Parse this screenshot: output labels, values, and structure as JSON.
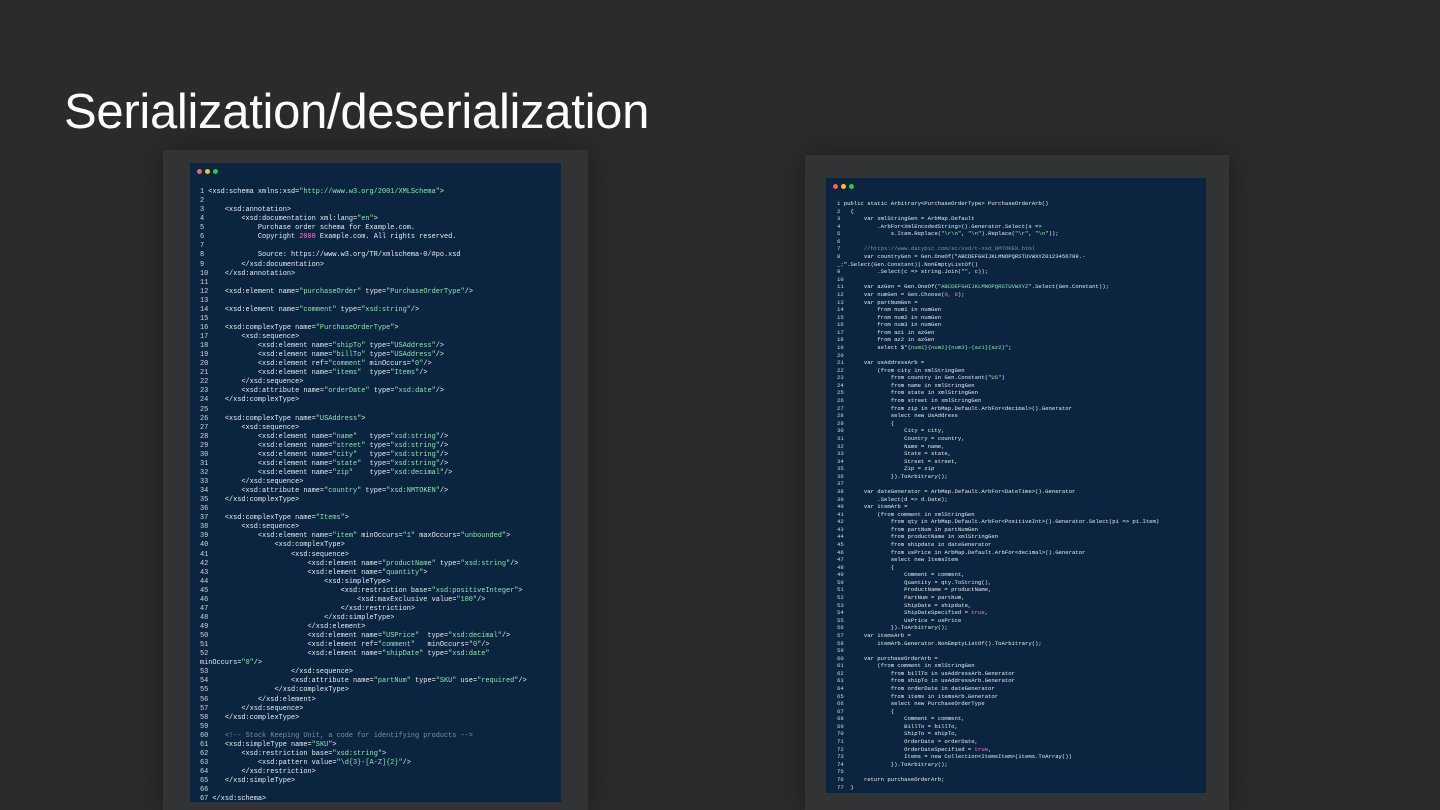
{
  "slide": {
    "title": "Serialization/deserialization"
  },
  "left_window": {
    "language": "xml",
    "lines": [
      "1 <xsd:schema xmlns:xsd=\"http://www.w3.org/2001/XMLSchema\">",
      "2",
      "3     <xsd:annotation>",
      "4         <xsd:documentation xml:lang=\"en\">",
      "5             Purchase order schema for Example.com.",
      "6             Copyright 2000 Example.com. All rights reserved.",
      "7",
      "8             Source: https://www.w3.org/TR/xmlschema-0/#po.xsd",
      "9         </xsd:documentation>",
      "10    </xsd:annotation>",
      "11",
      "12    <xsd:element name=\"purchaseOrder\" type=\"PurchaseOrderType\"/>",
      "13",
      "14    <xsd:element name=\"comment\" type=\"xsd:string\"/>",
      "15",
      "16    <xsd:complexType name=\"PurchaseOrderType\">",
      "17        <xsd:sequence>",
      "18            <xsd:element name=\"shipTo\" type=\"USAddress\"/>",
      "19            <xsd:element name=\"billTo\" type=\"USAddress\"/>",
      "20            <xsd:element ref=\"comment\" minOccurs=\"0\"/>",
      "21            <xsd:element name=\"items\"  type=\"Items\"/>",
      "22        </xsd:sequence>",
      "23        <xsd:attribute name=\"orderDate\" type=\"xsd:date\"/>",
      "24    </xsd:complexType>",
      "25",
      "26    <xsd:complexType name=\"USAddress\">",
      "27        <xsd:sequence>",
      "28            <xsd:element name=\"name\"   type=\"xsd:string\"/>",
      "29            <xsd:element name=\"street\" type=\"xsd:string\"/>",
      "30            <xsd:element name=\"city\"   type=\"xsd:string\"/>",
      "31            <xsd:element name=\"state\"  type=\"xsd:string\"/>",
      "32            <xsd:element name=\"zip\"    type=\"xsd:decimal\"/>",
      "33        </xsd:sequence>",
      "34        <xsd:attribute name=\"country\" type=\"xsd:NMTOKEN\"/>",
      "35    </xsd:complexType>",
      "36",
      "37    <xsd:complexType name=\"Items\">",
      "38        <xsd:sequence>",
      "39            <xsd:element name=\"item\" minOccurs=\"1\" maxOccurs=\"unbounded\">",
      "40                <xsd:complexType>",
      "41                    <xsd:sequence>",
      "42                        <xsd:element name=\"productName\" type=\"xsd:string\"/>",
      "43                        <xsd:element name=\"quantity\">",
      "44                            <xsd:simpleType>",
      "45                                <xsd:restriction base=\"xsd:positiveInteger\">",
      "46                                    <xsd:maxExclusive value=\"100\"/>",
      "47                                </xsd:restriction>",
      "48                            </xsd:simpleType>",
      "49                        </xsd:element>",
      "50                        <xsd:element name=\"USPrice\"  type=\"xsd:decimal\"/>",
      "51                        <xsd:element ref=\"comment\"   minOccurs=\"0\"/>",
      "52                        <xsd:element name=\"shipDate\" type=\"xsd:date\"",
      "minOccurs=\"0\"/>",
      "53                    </xsd:sequence>",
      "54                    <xsd:attribute name=\"partNum\" type=\"SKU\" use=\"required\"/>",
      "55                </xsd:complexType>",
      "56            </xsd:element>",
      "57        </xsd:sequence>",
      "58    </xsd:complexType>",
      "59",
      "60    <!-- Stock Keeping Unit, a code for identifying products -->",
      "61    <xsd:simpleType name=\"SKU\">",
      "62        <xsd:restriction base=\"xsd:string\">",
      "63            <xsd:pattern value=\"\\d{3}-[A-Z]{2}\"/>",
      "64        </xsd:restriction>",
      "65    </xsd:simpleType>",
      "66",
      "67 </xsd:schema>"
    ]
  },
  "right_window": {
    "language": "csharp",
    "lines": [
      "1 public static Arbitrary<PurchaseOrderType> PurchaseOrderArb()",
      "2   {",
      "3       var xmlStringGen = ArbMap.Default",
      "4           .ArbFor<XmlEncodedString>().Generator.Select(s =>",
      "5               s.Item.Replace(\"\\r\\n\", \"\\n\").Replace(\"\\r\", \"\\n\"));",
      "6",
      "7       //https://www.datypic.com/sc/xsd/t-xsd_NMTOKEN.html",
      "8       var countryGen = Gen.OneOf(\"ABCDEFGHIJKLMNOPQRSTUVWXYZ0123456789.-",
      "_:\".Select(Gen.Constant)).NonEmptyListOf()",
      "9           .Select(c => string.Join(\"\", c));",
      "10",
      "11      var azGen = Gen.OneOf(\"ABCDEFGHIJKLMNOPQRSTUVWXYZ\".Select(Gen.Constant));",
      "12      var numGen = Gen.Choose(0, 9);",
      "13      var partNumGen =",
      "14          from num1 in numGen",
      "15          from num2 in numGen",
      "16          from num3 in numGen",
      "17          from az1 in azGen",
      "18          from az2 in azGen",
      "19          select $\"{num1}{num2}{num3}-{az1}{az2}\";",
      "20",
      "21      var usAddressArb =",
      "22          (from city in xmlStringGen",
      "23              from country in Gen.Constant(\"US\")",
      "24              from name in xmlStringGen",
      "25              from state in xmlStringGen",
      "26              from street in xmlStringGen",
      "27              from zip in ArbMap.Default.ArbFor<decimal>().Generator",
      "28              select new UsAddress",
      "29              {",
      "30                  City = city,",
      "31                  Country = country,",
      "32                  Name = name,",
      "33                  State = state,",
      "34                  Street = street,",
      "35                  Zip = zip",
      "36              }).ToArbitrary();",
      "37",
      "38      var dateGenerator = ArbMap.Default.ArbFor<DateTime>().Generator",
      "39          .Select(d => d.Date);",
      "40      var itemArb =",
      "41          (from comment in xmlStringGen",
      "42              from qty in ArbMap.Default.ArbFor<PositiveInt>().Generator.Select(pi => pi.Item)",
      "43              from partNum in partNumGen",
      "44              from productName in xmlStringGen",
      "45              from shipdate in dateGenerator",
      "46              from usPrice in ArbMap.Default.ArbFor<decimal>().Generator",
      "47              select new ItemsItem",
      "48              {",
      "49                  Comment = comment,",
      "50                  Quantity = qty.ToString(),",
      "51                  ProductName = productName,",
      "52                  PartNum = partNum,",
      "53                  ShipDate = shipdate,",
      "54                  ShipDateSpecified = true,",
      "55                  UsPrice = usPrice",
      "56              }).ToArbitrary();",
      "57      var itemsArb =",
      "58          itemArb.Generator.NonEmptyListOf().ToArbitrary();",
      "59",
      "60      var purchaseOrderArb =",
      "61          (from comment in xmlStringGen",
      "62              from billTo in usAddressArb.Generator",
      "63              from shipTo in usAddressArb.Generator",
      "64              from orderDate in dateGenerator",
      "65              from items in itemsArb.Generator",
      "66              select new PurchaseOrderType",
      "67              {",
      "68                  Comment = comment,",
      "69                  BillTo = billTo,",
      "70                  ShipTo = shipTo,",
      "71                  OrderDate = orderDate,",
      "72                  OrderDateSpecified = true,",
      "73                  Items = new Collection<ItemsItem>(items.ToArray())",
      "74              }).ToArbitrary();",
      "75",
      "76      return purchaseOrderArb;",
      "77  }"
    ]
  },
  "colors": {
    "slide_background": "#2b2b2b",
    "code_background": "#0b2540",
    "code_text": "#e6edf3",
    "string_literal": "#8fe3b1",
    "keyword_value": "#ff7bd5",
    "comment": "#7a8fa6",
    "dot_red": "#ff5f56",
    "dot_yellow": "#ffbd2e",
    "dot_green": "#27c93f"
  }
}
